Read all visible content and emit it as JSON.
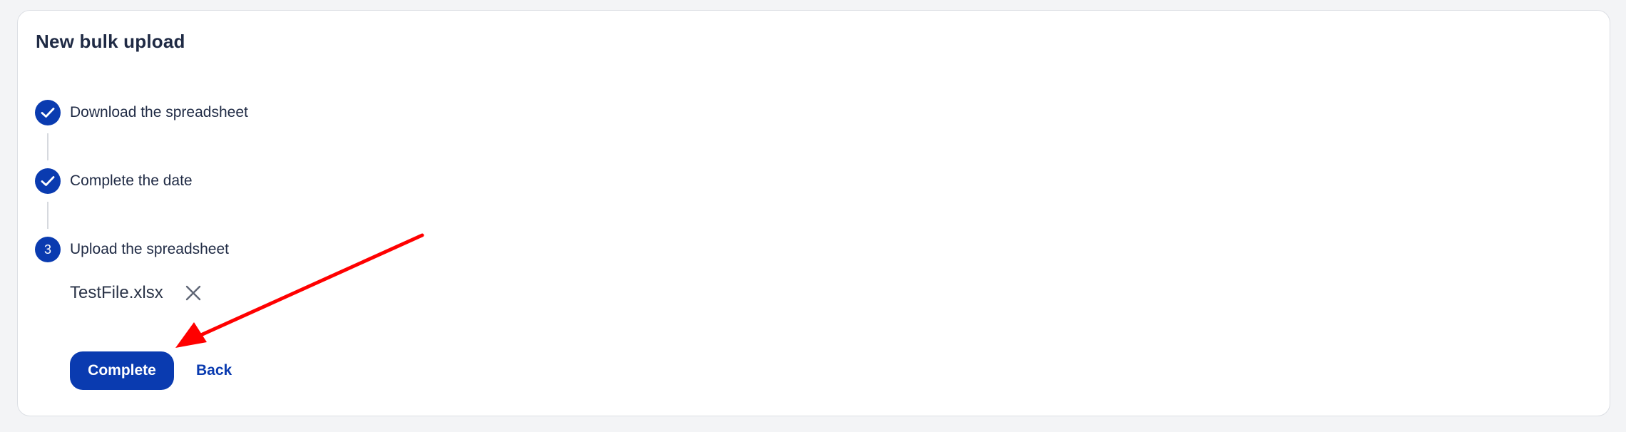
{
  "card": {
    "title": "New bulk upload"
  },
  "steps": [
    {
      "status": "completed",
      "marker": "",
      "label": "Download the spreadsheet"
    },
    {
      "status": "completed",
      "marker": "",
      "label": "Complete the date"
    },
    {
      "status": "active",
      "marker": "3",
      "label": "Upload the spreadsheet"
    }
  ],
  "upload": {
    "file_name": "TestFile.xlsx",
    "remove_icon": "close-icon"
  },
  "actions": {
    "complete_label": "Complete",
    "back_label": "Back"
  },
  "colors": {
    "accent": "#0a3bb0",
    "annotation_arrow": "#ff0000"
  }
}
